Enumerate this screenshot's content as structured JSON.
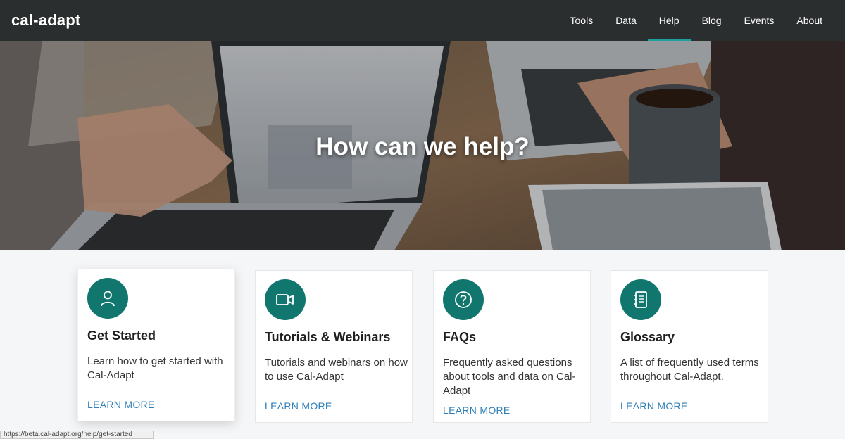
{
  "nav": {
    "logo": "cal-adapt",
    "items": [
      {
        "label": "Tools"
      },
      {
        "label": "Data"
      },
      {
        "label": "Help"
      },
      {
        "label": "Blog"
      },
      {
        "label": "Events"
      },
      {
        "label": "About"
      }
    ],
    "active": "Help"
  },
  "hero": {
    "title": "How can we help?"
  },
  "cards": [
    {
      "icon": "user-icon",
      "title": "Get Started",
      "desc": "Learn how to get started with Cal-Adapt",
      "link": "LEARN MORE"
    },
    {
      "icon": "video-camera-icon",
      "title": "Tutorials & Webinars",
      "desc": "Tutorials and webinars on how to use Cal-Adapt",
      "link": "LEARN MORE"
    },
    {
      "icon": "question-circle-icon",
      "title": "FAQs",
      "desc": "Frequently asked questions about tools and data on Cal-Adapt",
      "link": "LEARN MORE"
    },
    {
      "icon": "notebook-icon",
      "title": "Glossary",
      "desc": "A list of frequently used terms throughout Cal-Adapt.",
      "link": "LEARN MORE"
    }
  ],
  "status_url": "https://beta.cal-adapt.org/help/get-started",
  "colors": {
    "nav_bg": "#2b2e2e",
    "accent_underline": "#18a3a0",
    "icon_circle": "#11776e",
    "link": "#2f7fb8"
  }
}
